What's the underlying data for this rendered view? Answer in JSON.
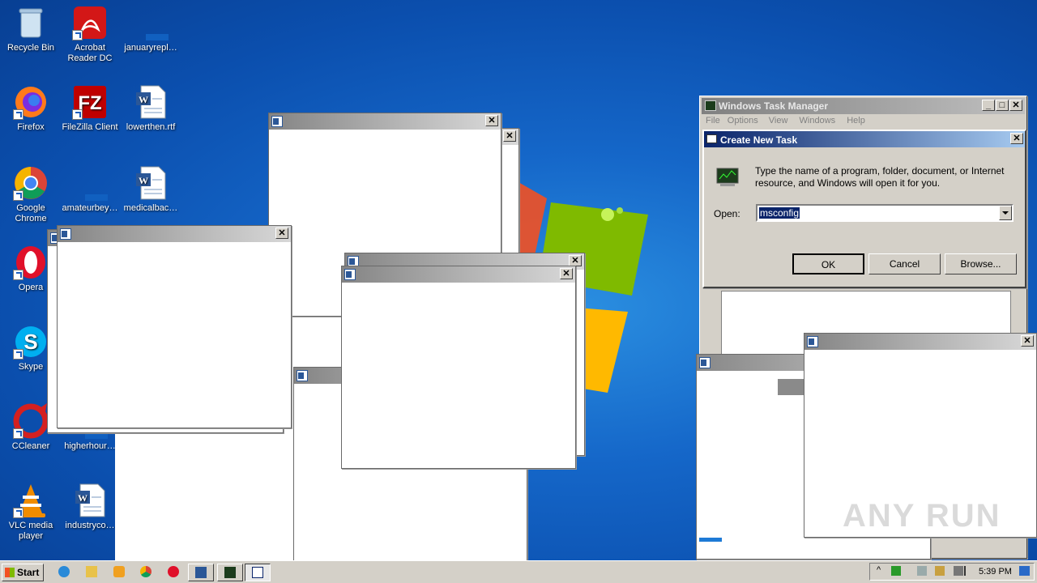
{
  "desktop": {
    "icons": [
      {
        "label": "Recycle Bin",
        "icon": "recycle-bin-icon"
      },
      {
        "label": "Acrobat Reader DC",
        "icon": "acrobat-icon"
      },
      {
        "label": "januaryrepl…",
        "icon": "file-icon"
      },
      {
        "label": "Firefox",
        "icon": "firefox-icon"
      },
      {
        "label": "FileZilla Client",
        "icon": "filezilla-icon"
      },
      {
        "label": "lowerthen.rtf",
        "icon": "word-doc-icon"
      },
      {
        "label": "Google Chrome",
        "icon": "chrome-icon"
      },
      {
        "label": "amateurbey…",
        "icon": "file-icon"
      },
      {
        "label": "medicalbac…",
        "icon": "word-doc-icon"
      },
      {
        "label": "Opera",
        "icon": "opera-icon"
      },
      {
        "label": "Skype",
        "icon": "skype-icon"
      },
      {
        "label": "CCleaner",
        "icon": "ccleaner-icon"
      },
      {
        "label": "higherhour…",
        "icon": "file-icon"
      },
      {
        "label": "VLC media player",
        "icon": "vlc-icon"
      },
      {
        "label": "industryco…",
        "icon": "word-doc-icon"
      }
    ],
    "watermark": "ANY RUN"
  },
  "task_manager": {
    "title": "Windows Task Manager",
    "menu": [
      "File",
      "Options",
      "View",
      "Windows",
      "Help"
    ]
  },
  "run_dialog": {
    "title": "Create New Task",
    "description": "Type the name of a program, folder, document, or Internet resource, and Windows will open it for you.",
    "open_label": "Open:",
    "open_value": "msconfig",
    "ok": "OK",
    "cancel": "Cancel",
    "browse": "Browse..."
  },
  "taskbar": {
    "start_label": "Start",
    "clock": "5:39 PM"
  },
  "colors": {
    "desktop_blue": "#1567c9",
    "title_active": "#0a246a",
    "selection": "#0a246a"
  }
}
